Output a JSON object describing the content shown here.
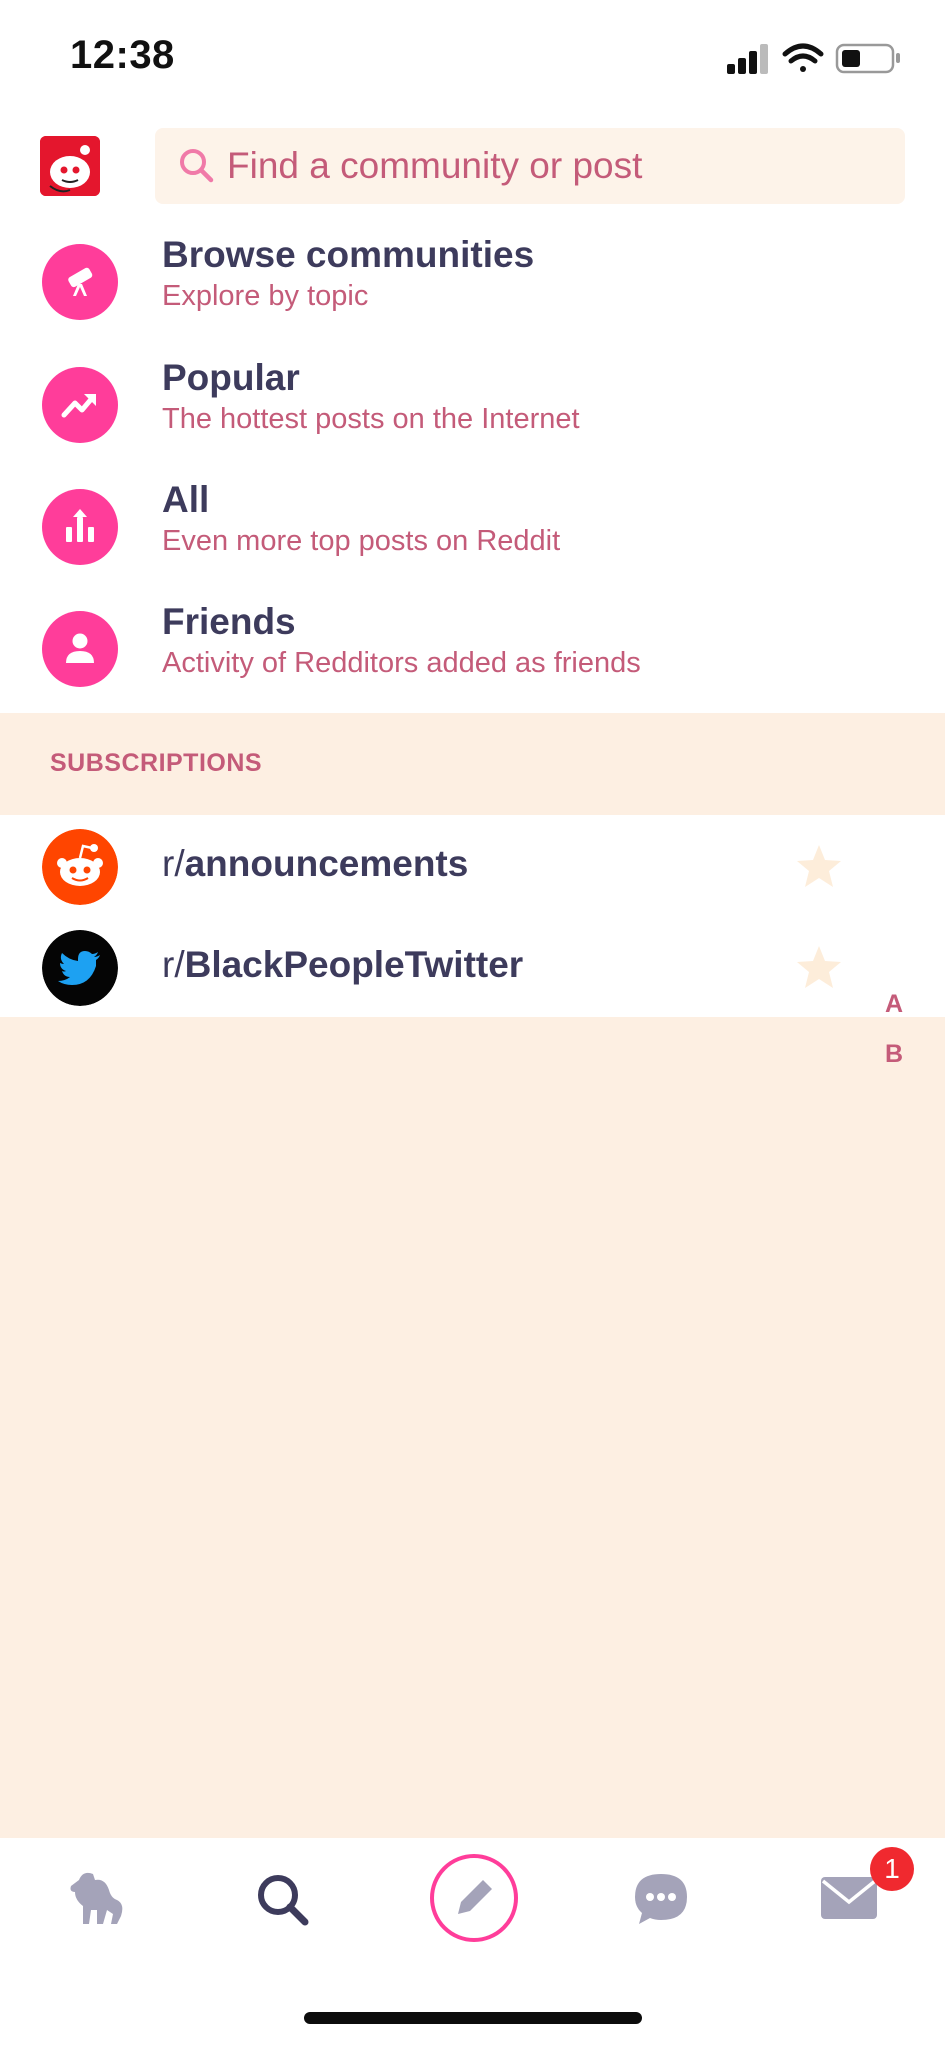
{
  "status_bar": {
    "time": "12:38"
  },
  "search": {
    "placeholder": "Find a community or post"
  },
  "nav_items": [
    {
      "title": "Browse communities",
      "subtitle": "Explore by topic",
      "icon": "telescope-icon"
    },
    {
      "title": "Popular",
      "subtitle": "The hottest posts on the Internet",
      "icon": "trending-up-icon"
    },
    {
      "title": "All",
      "subtitle": "Even more top posts on Reddit",
      "icon": "bar-chart-icon"
    },
    {
      "title": "Friends",
      "subtitle": "Activity of Redditors added as friends",
      "icon": "person-icon"
    }
  ],
  "subscriptions": {
    "header": "SUBSCRIPTIONS",
    "items": [
      {
        "prefix": "r/",
        "name": "announcements",
        "icon": "reddit-alien-icon"
      },
      {
        "prefix": "r/",
        "name": "BlackPeopleTwitter",
        "icon": "twitter-bird-icon"
      }
    ],
    "index_letters": [
      "A",
      "B"
    ]
  },
  "tab_bar": {
    "tabs": [
      "home-pony-icon",
      "search-icon",
      "compose-pencil-icon",
      "chat-bubble-icon",
      "mail-icon"
    ],
    "mail_badge": "1"
  },
  "colors": {
    "accent_pink": "#ff3d9a",
    "subtitle_pink": "#c45b79",
    "title_navy": "#3d3b5c",
    "cream_bg": "#fdefe2"
  }
}
